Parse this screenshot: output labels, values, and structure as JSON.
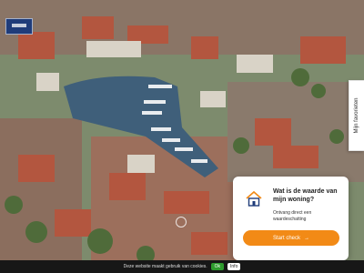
{
  "favorites": {
    "label": "Mijn favorieten"
  },
  "valuation_card": {
    "title": "Wat is de waarde van mijn woning?",
    "subtitle": "Ontvang direct een waardeschatting",
    "button_label": "Start check",
    "button_arrow": "→",
    "accent_color": "#f28a16",
    "icon": "house-icon"
  },
  "cookie_bar": {
    "text": "Deze website maakt gebruik van cookies.",
    "ok_label": "Ok",
    "info_label": "Info"
  }
}
